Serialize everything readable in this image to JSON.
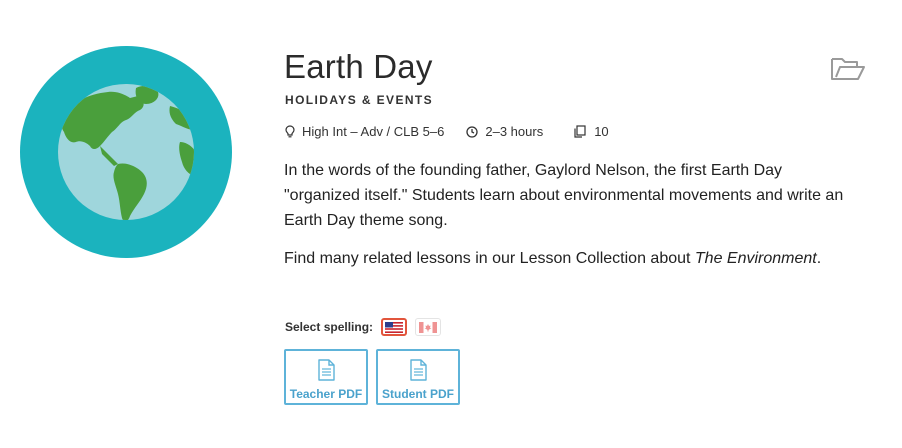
{
  "lesson": {
    "title": "Earth Day",
    "category": "HOLIDAYS & EVENTS",
    "meta": {
      "level": "High Int – Adv / CLB 5–6",
      "duration": "2–3 hours",
      "pages": "10"
    },
    "description": "In the words of the founding father, Gaylord Nelson, the first Earth Day \"organized itself.\" Students learn about environmental movements and write an Earth Day theme song.",
    "related_text": "Find many related lessons in our Lesson Collection about ",
    "related_link": "The Environment",
    "related_end": "."
  },
  "spelling": {
    "label": "Select spelling:",
    "selected": "US"
  },
  "downloads": {
    "teacher_label": "Teacher PDF",
    "student_label": "Student PDF"
  },
  "icons": {
    "globe": "globe-icon",
    "folder": "folder-open-icon",
    "level": "lightbulb-icon",
    "duration": "clock-icon",
    "pages": "pages-icon",
    "pdf": "document-icon"
  },
  "colors": {
    "globe_ring": "#1bb3be",
    "ocean": "#9fd6dc",
    "land": "#4a9f3c",
    "pdf_accent": "#5eb3d9",
    "selected_flag_border": "#e2553c"
  }
}
